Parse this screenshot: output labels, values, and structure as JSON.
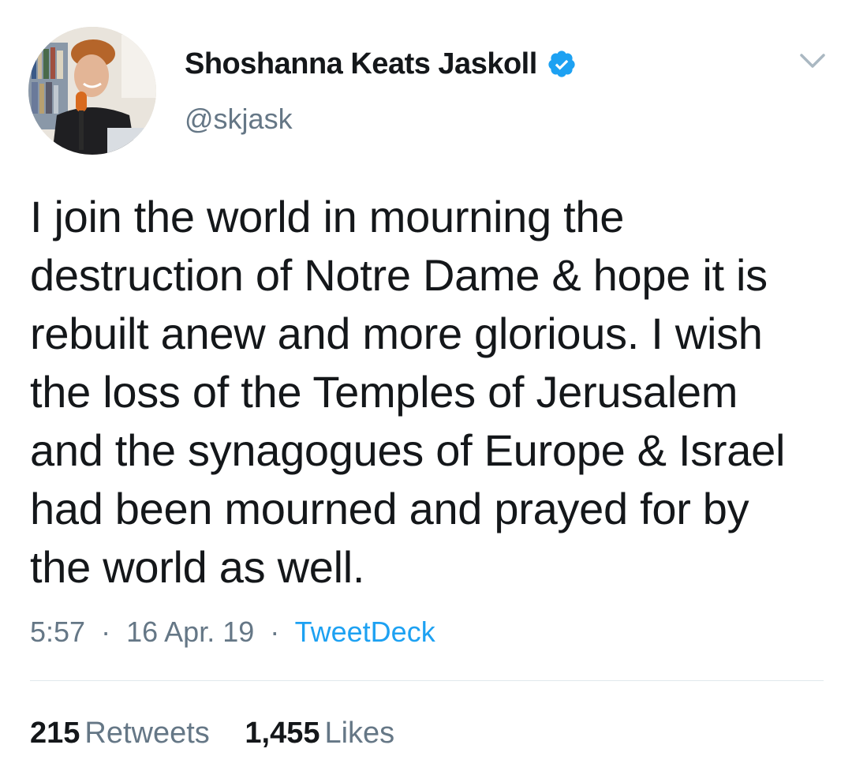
{
  "tweet": {
    "author": {
      "display_name": "Shoshanna Keats Jaskoll",
      "handle": "@skjask",
      "verified": true,
      "verified_icon": "verified-badge-icon",
      "avatar_icon": "avatar"
    },
    "menu_icon": "chevron-down-icon",
    "text": "I join the world in mourning the\ndestruction of Notre Dame & hope it is\nrebuilt anew and more glorious. I wish\nthe loss of the Temples of Jerusalem\nand the synagogues of Europe & Israel\nhad been mourned and prayed for by\nthe world as well.",
    "time": "5:57",
    "separator": "·",
    "date": "16 Apr. 19",
    "source": "TweetDeck",
    "stats": {
      "retweets_count": "215",
      "retweets_label": "Retweets",
      "likes_count": "1,455",
      "likes_label": "Likes"
    }
  },
  "colors": {
    "text_primary": "#14171a",
    "text_secondary": "#657786",
    "accent": "#1da1f2",
    "divider": "#e1e8ed"
  }
}
